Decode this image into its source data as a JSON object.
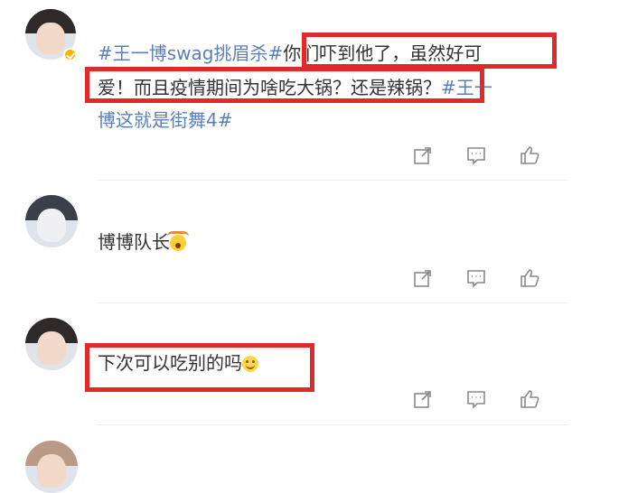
{
  "comments": [
    {
      "topic1": "#王一博swag挑眉杀#",
      "text_line1": "你们吓到他了，虽然好可",
      "text_line2": "爱！而且疫情期间为啥吃大锅？还是辣锅？",
      "topic2_part1": "#王一",
      "topic2_part2": "博这就是街舞4#",
      "verified": true
    },
    {
      "text": "博博队长",
      "emoji": "wow-emoji"
    },
    {
      "text": "下次可以吃别的吗",
      "emoji": "smile-emoji"
    }
  ],
  "actions": [
    "share-icon",
    "comment-icon",
    "like-icon"
  ],
  "colors": {
    "highlight_box": "#e0292a",
    "topic_link": "#5b7fb8",
    "body_text": "#333333",
    "verified_badge": "#f7b500"
  }
}
